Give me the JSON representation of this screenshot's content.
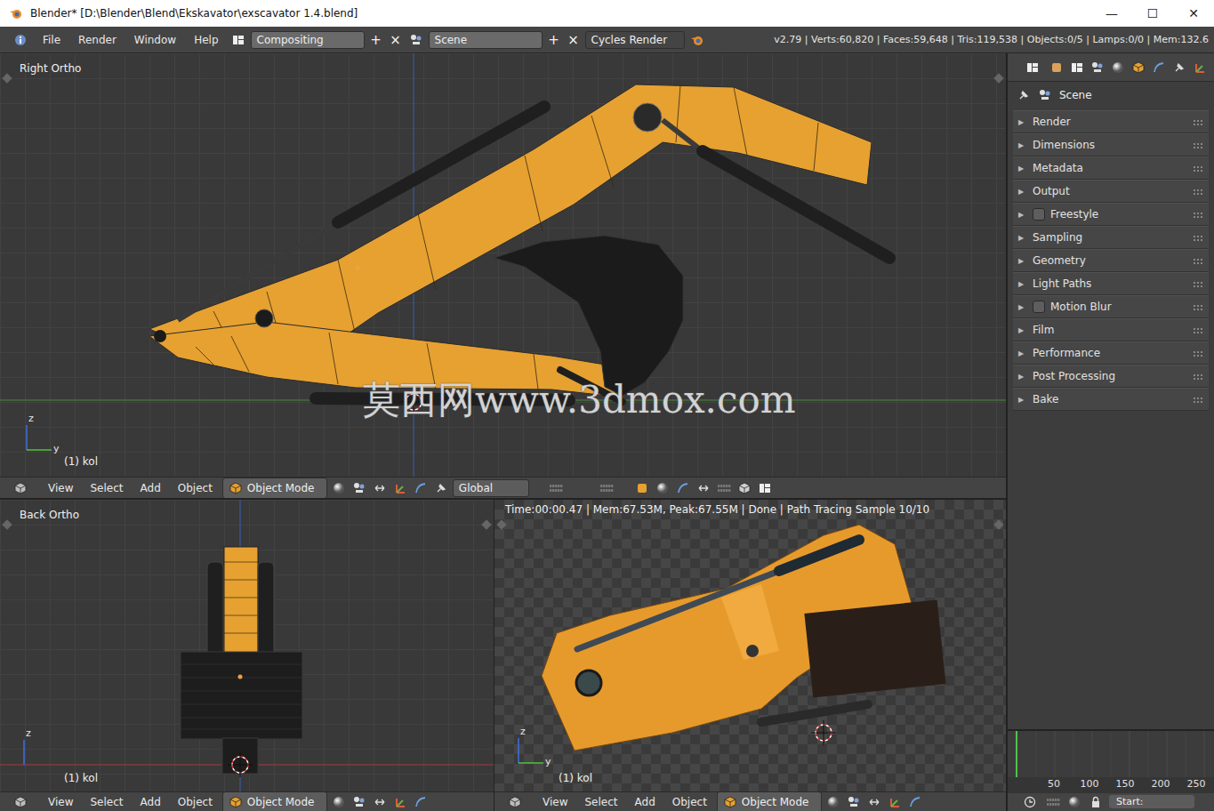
{
  "window": {
    "title": "Blender* [D:\\Blender\\Blend\\Ekskavator\\exscavator 1.4.blend]",
    "controls": [
      "—",
      "☐",
      "✕"
    ]
  },
  "info_header": {
    "menus": [
      "File",
      "Render",
      "Window",
      "Help"
    ],
    "screen": "Compositing",
    "scene": "Scene",
    "add_button": "+",
    "remove_button": "×",
    "engine": "Cycles Render",
    "stats": "v2.79 | Verts:60,820 | Faces:59,648 | Tris:119,538 | Objects:0/5 | Lamps:0/0 | Mem:132.6"
  },
  "viewports": {
    "right": {
      "label": "Right Ortho",
      "object": "(1) kol",
      "axes": [
        "z",
        "y"
      ],
      "menus": [
        "View",
        "Select",
        "Add",
        "Object"
      ],
      "mode": "Object Mode",
      "orientation": "Global"
    },
    "back": {
      "label": "Back Ortho",
      "object": "(1) kol",
      "axes": [
        "z"
      ],
      "menus": [
        "View",
        "Select",
        "Add",
        "Object"
      ],
      "mode": "Object Mode"
    },
    "render": {
      "status": "Time:00:00.47 | Mem:67.53M, Peak:67.55M | Done | Path Tracing Sample 10/10",
      "object": "(1) kol",
      "axes": [
        "z",
        "y"
      ],
      "menus": [
        "View",
        "Select",
        "Add",
        "Object"
      ],
      "mode": "Object Mode"
    }
  },
  "watermark": "莫西网www.3dmox.com",
  "properties": {
    "context": "Scene",
    "arrow": "▶",
    "panels": [
      {
        "label": "Render",
        "kind": "plain",
        "expanded": false,
        "checked": false
      },
      {
        "label": "Dimensions",
        "kind": "plain",
        "expanded": false,
        "checked": false
      },
      {
        "label": "Metadata",
        "kind": "plain",
        "expanded": false,
        "checked": false
      },
      {
        "label": "Output",
        "kind": "plain",
        "expanded": false,
        "checked": false
      },
      {
        "label": "Freestyle",
        "kind": "toggle",
        "expanded": false,
        "checked": false
      },
      {
        "label": "Sampling",
        "kind": "plain",
        "expanded": false,
        "checked": false
      },
      {
        "label": "Geometry",
        "kind": "plain",
        "expanded": false,
        "checked": false
      },
      {
        "label": "Light Paths",
        "kind": "plain",
        "expanded": false,
        "checked": false
      },
      {
        "label": "Motion Blur",
        "kind": "toggle",
        "expanded": false,
        "checked": false
      },
      {
        "label": "Film",
        "kind": "plain",
        "expanded": false,
        "checked": false
      },
      {
        "label": "Performance",
        "kind": "plain",
        "expanded": false,
        "checked": false
      },
      {
        "label": "Post Processing",
        "kind": "plain",
        "expanded": false,
        "checked": false
      },
      {
        "label": "Bake",
        "kind": "plain",
        "expanded": false,
        "checked": false
      }
    ]
  },
  "timeline": {
    "ticks": [
      "50",
      "100",
      "150",
      "200",
      "250"
    ],
    "start_label": "Start:"
  }
}
